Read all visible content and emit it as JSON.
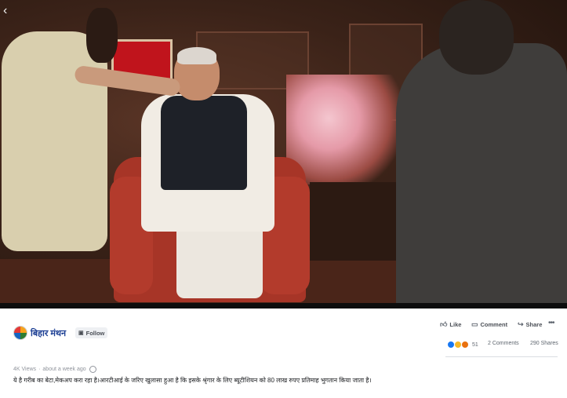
{
  "video": {
    "back_icon": "chevron-left-icon"
  },
  "post": {
    "page_name": "बिहार मंथन",
    "follow_label": "Follow",
    "actions": {
      "like_label": "Like",
      "comment_label": "Comment",
      "share_label": "Share",
      "more_icon": "ellipsis-icon"
    },
    "reactions_count": "51",
    "comments_count": "2 Comments",
    "shares_count": "290 Shares",
    "views": "4K Views",
    "time": "about a week ago",
    "caption": "ये है गरीब का बेटा,मेकअप करा रहा है।आरटीआई के जरिए खुलासा हुआ है कि इसके श्रृंगार के लिए ब्यूटीशियन को 80 लाख रुपए प्रतिमाह भुगतान किया जाता है।"
  },
  "colors": {
    "page_name": "#1c3f94",
    "like_reaction": "#1877f2",
    "haha_reaction": "#f7b928",
    "angry_reaction": "#e9710f"
  }
}
